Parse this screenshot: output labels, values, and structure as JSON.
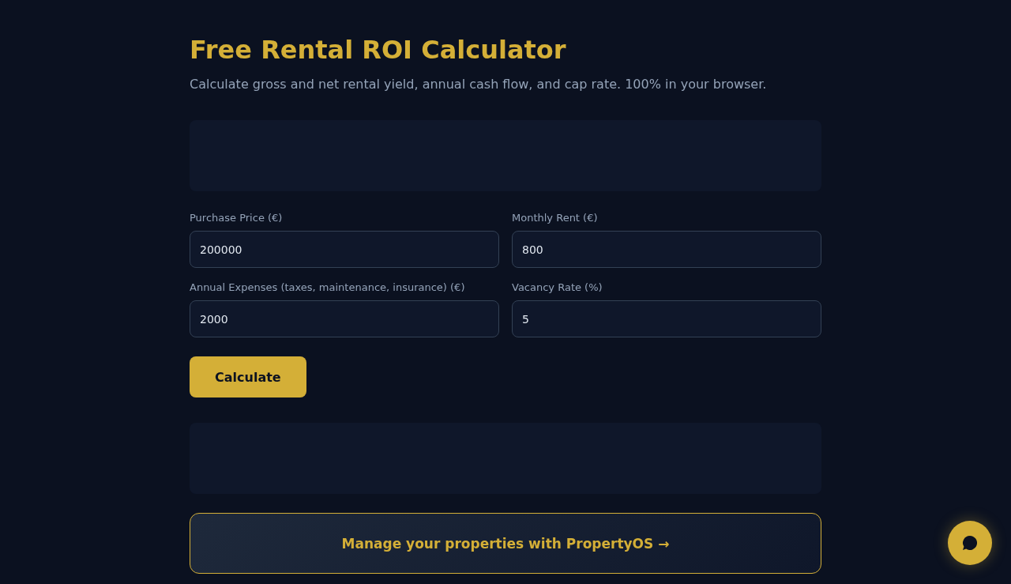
{
  "header": {
    "title": "Free Rental ROI Calculator",
    "subtitle": "Calculate gross and net rental yield, annual cash flow, and cap rate. 100% in your browser."
  },
  "fields": [
    {
      "label": "Purchase Price (€)",
      "value": "200000"
    },
    {
      "label": "Monthly Rent (€)",
      "value": "800"
    },
    {
      "label": "Annual Expenses (taxes, maintenance, insurance) (€)",
      "value": "2000"
    },
    {
      "label": "Vacancy Rate (%)",
      "value": "5"
    }
  ],
  "calculate_button": {
    "label": "Calculate"
  },
  "promo_link": {
    "label": "Manage your properties with PropertyOS →"
  },
  "chat_button": {
    "kind": "chat"
  }
}
